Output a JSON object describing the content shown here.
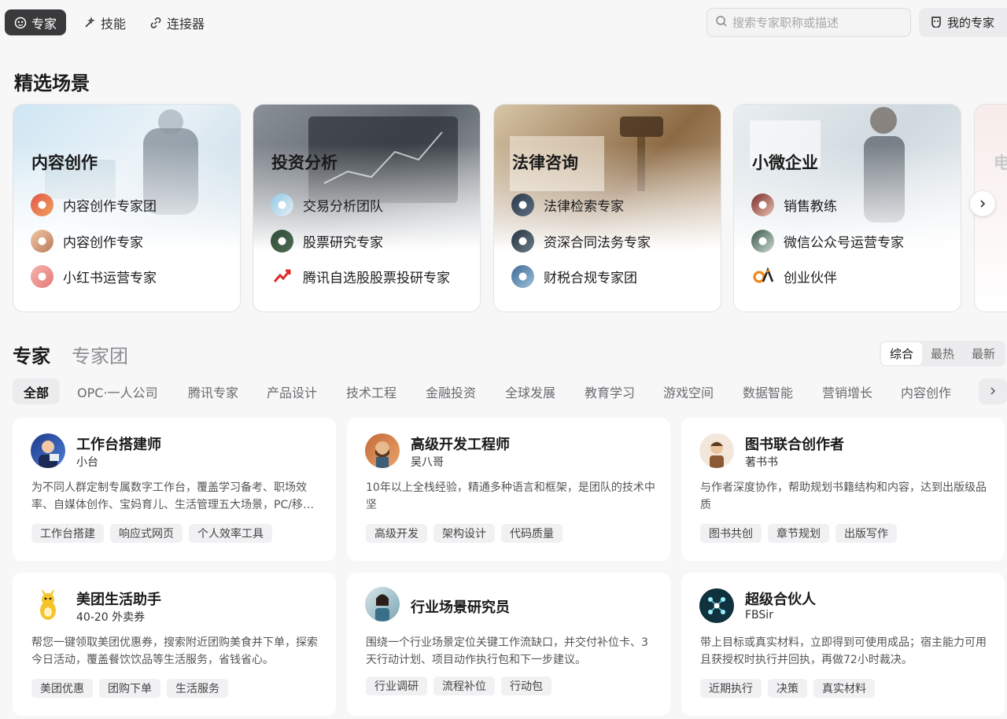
{
  "nav": {
    "tabs": [
      {
        "label": "专家",
        "icon": "robot-face-icon"
      },
      {
        "label": "技能",
        "icon": "magic-wand-icon"
      },
      {
        "label": "连接器",
        "icon": "link-icon"
      }
    ],
    "search_placeholder": "搜索专家职称或描述",
    "my_experts_label": "我的专家"
  },
  "featured": {
    "title": "精选场景",
    "scenes": [
      {
        "name": "内容创作",
        "items": [
          "内容创作专家团",
          "内容创作专家",
          "小红书运营专家"
        ]
      },
      {
        "name": "投资分析",
        "items": [
          "交易分析团队",
          "股票研究专家",
          "腾讯自选股股票投研专家"
        ]
      },
      {
        "name": "法律咨询",
        "items": [
          "法律检索专家",
          "资深合同法务专家",
          "财税合规专家团"
        ]
      },
      {
        "name": "小微企业",
        "items": [
          "销售教练",
          "微信公众号运营专家",
          "创业伙伴"
        ]
      }
    ],
    "partial_scene_initial": "电"
  },
  "experts_section": {
    "tab_experts": "专家",
    "tab_teams": "专家团",
    "sort": [
      "综合",
      "最热",
      "最新"
    ],
    "categories": [
      "全部",
      "OPC·一人公司",
      "腾讯专家",
      "产品设计",
      "技术工程",
      "金融投资",
      "全球发展",
      "教育学习",
      "游戏空间",
      "数据智能",
      "营销增长",
      "内容创作"
    ]
  },
  "cards": [
    {
      "name": "工作台搭建师",
      "sub": "小台",
      "desc": "为不同人群定制专属数字工作台，覆盖学习备考、职场效率、自媒体创作、宝妈育儿、生活管理五大场景，PC/移动端全适配",
      "tags": [
        "工作台搭建",
        "响应式网页",
        "个人效率工具"
      ]
    },
    {
      "name": "高级开发工程师",
      "sub": "吴八哥",
      "desc": "10年以上全栈经验，精通多种语言和框架，是团队的技术中坚",
      "tags": [
        "高级开发",
        "架构设计",
        "代码质量"
      ]
    },
    {
      "name": "图书联合创作者",
      "sub": "著书书",
      "desc": "与作者深度协作，帮助规划书籍结构和内容，达到出版级品质",
      "tags": [
        "图书共创",
        "章节规划",
        "出版写作"
      ]
    },
    {
      "name": "美团生活助手",
      "sub": "40-20 外卖券",
      "desc": "帮您一键领取美团优惠券，搜索附近团购美食并下单，探索今日活动，覆盖餐饮饮品等生活服务，省钱省心。",
      "tags": [
        "美团优惠",
        "团购下单",
        "生活服务"
      ]
    },
    {
      "name": "行业场景研究员",
      "sub": "",
      "desc": "围绕一个行业场景定位关键工作流缺口，并交付补位卡、3天行动计划、项目动作执行包和下一步建议。",
      "tags": [
        "行业调研",
        "流程补位",
        "行动包"
      ]
    },
    {
      "name": "超级合伙人",
      "sub": "FBSir",
      "desc": "带上目标或真实材料，立即得到可使用成品；宿主能力可用且获授权时执行并回执，再做72小时裁决。",
      "tags": [
        "近期执行",
        "决策",
        "真实材料"
      ]
    }
  ]
}
